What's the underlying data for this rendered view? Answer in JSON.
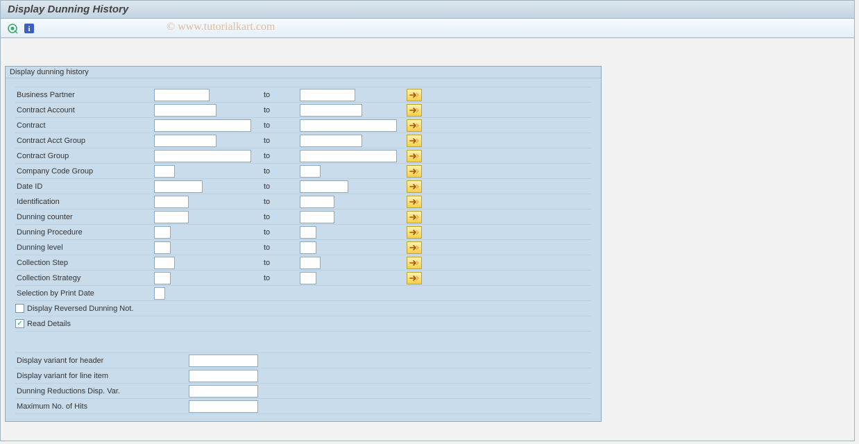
{
  "window": {
    "title": "Display Dunning History"
  },
  "watermark": "© www.tutorialkart.com",
  "group": {
    "title": "Display dunning history",
    "to_label": "to",
    "fields": [
      {
        "label": "Business Partner",
        "fw": 80,
        "tw": 80,
        "arrow": true
      },
      {
        "label": "Contract Account",
        "fw": 90,
        "tw": 90,
        "arrow": true
      },
      {
        "label": "Contract",
        "fw": 140,
        "tw": 140,
        "arrow": true
      },
      {
        "label": "Contract Acct Group",
        "fw": 90,
        "tw": 90,
        "arrow": true
      },
      {
        "label": "Contract Group",
        "fw": 140,
        "tw": 140,
        "arrow": true
      },
      {
        "label": "Company Code Group",
        "fw": 30,
        "tw": 30,
        "arrow": true
      },
      {
        "label": "Date ID",
        "fw": 70,
        "tw": 70,
        "arrow": true
      },
      {
        "label": "Identification",
        "fw": 50,
        "tw": 50,
        "arrow": true
      },
      {
        "label": "Dunning counter",
        "fw": 50,
        "tw": 50,
        "arrow": true
      },
      {
        "label": "Dunning Procedure",
        "fw": 24,
        "tw": 24,
        "arrow": true
      },
      {
        "label": "Dunning level",
        "fw": 24,
        "tw": 24,
        "arrow": true
      },
      {
        "label": "Collection Step",
        "fw": 30,
        "tw": 30,
        "arrow": true
      },
      {
        "label": "Collection Strategy",
        "fw": 24,
        "tw": 24,
        "arrow": true
      },
      {
        "label": "Selection by Print Date",
        "fw": 16,
        "single": true
      }
    ],
    "checks": [
      {
        "label": "Display Reversed Dunning Not.",
        "checked": false
      },
      {
        "label": "Read Details",
        "checked": true
      }
    ],
    "settings": [
      {
        "label": "Display variant for header",
        "fw": 100
      },
      {
        "label": "Display variant for line item",
        "fw": 100
      },
      {
        "label": "Dunning Reductions Disp. Var.",
        "fw": 100
      },
      {
        "label": "Maximum No. of Hits",
        "fw": 100
      }
    ]
  }
}
